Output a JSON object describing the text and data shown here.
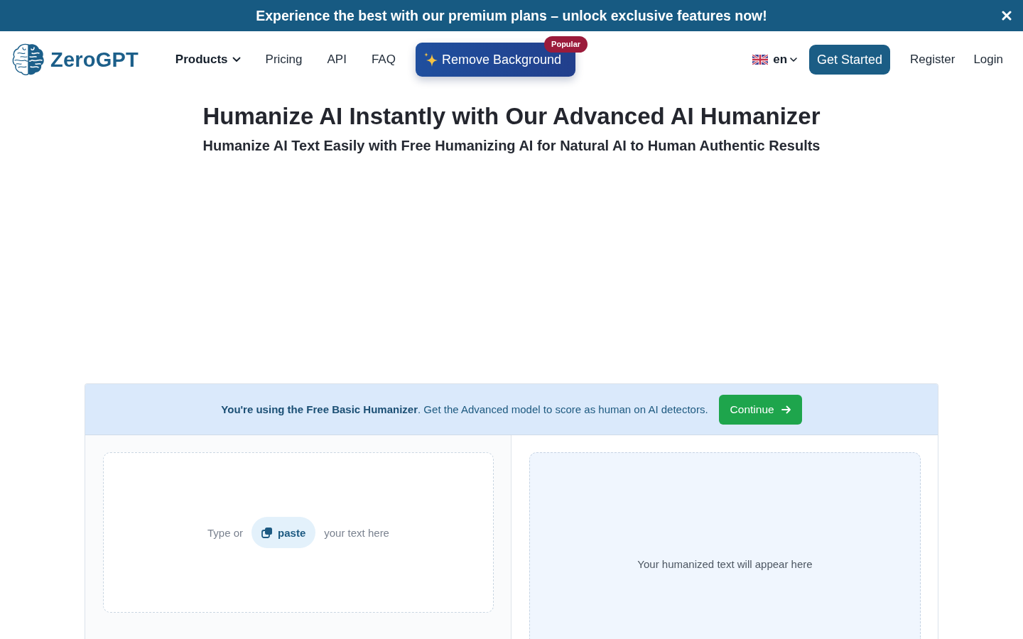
{
  "promo_banner": {
    "message": "Experience the best with our premium plans – unlock exclusive features now!"
  },
  "header": {
    "logo": {
      "text": "ZeroGPT"
    },
    "nav": [
      {
        "label": "Products",
        "kind": "dropdown"
      },
      {
        "label": "Pricing",
        "kind": "link"
      },
      {
        "label": "API",
        "kind": "link"
      },
      {
        "label": "FAQ",
        "kind": "link"
      },
      {
        "label": "Remove Background",
        "kind": "featured",
        "badge": "Popular"
      }
    ],
    "language": {
      "code": "en"
    },
    "actions": [
      {
        "label": "Get Started",
        "kind": "primary"
      },
      {
        "label": "Register",
        "kind": "link"
      },
      {
        "label": "Login",
        "kind": "link"
      }
    ]
  },
  "hero": {
    "title": "Humanize AI Instantly with Our Advanced AI Humanizer",
    "subtitle": "Humanize AI Text Easily with Free Humanizing AI for Natural AI to Human Authentic Results"
  },
  "humanizer": {
    "notice": {
      "text": "**You're using the Free Basic Humanizer**. Get the Advanced model to score as human on AI detectors.",
      "button": "Continue"
    },
    "input": {
      "placeholder_before": "Type or",
      "paste_button": "paste",
      "placeholder_after": "your text here"
    },
    "output": {
      "placeholder": "Your humanized text will appear here"
    }
  }
}
